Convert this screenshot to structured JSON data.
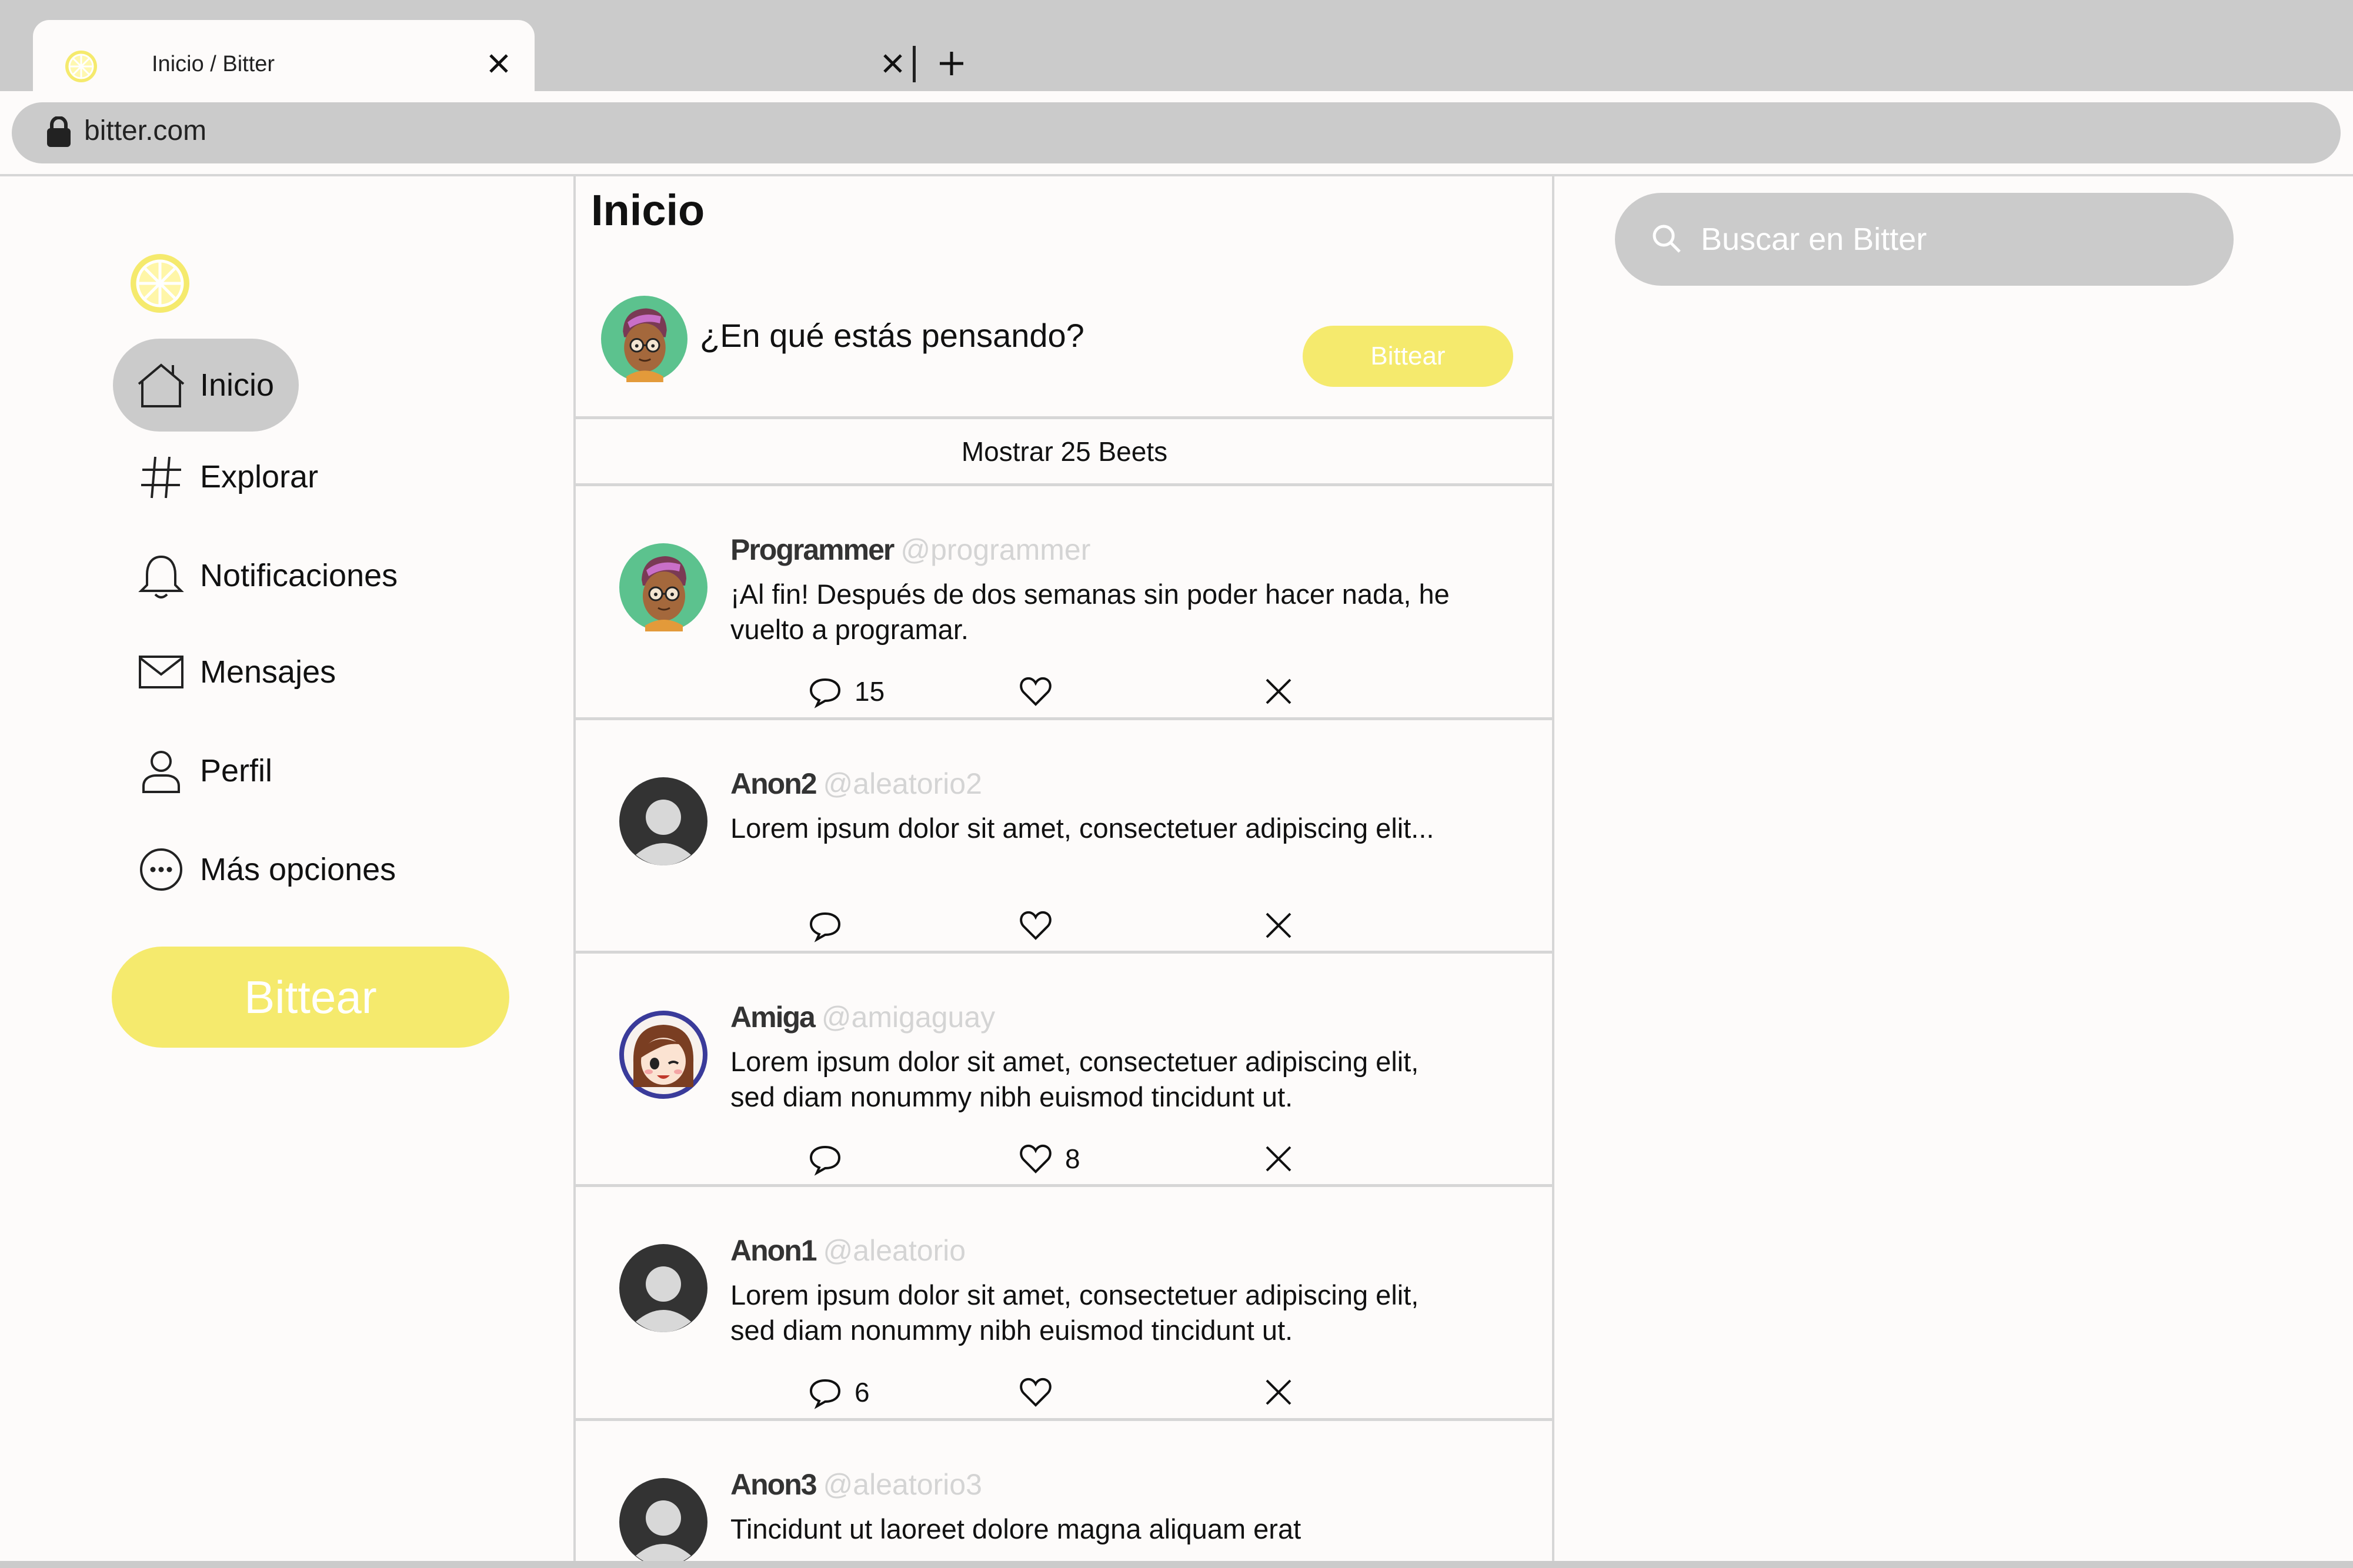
{
  "browser": {
    "tab_title": "Inicio / Bitter",
    "url": "bitter.com",
    "icons": {
      "tab": "lemon-icon",
      "close": "close-icon",
      "new_tab": "plus-icon",
      "lock": "lock-icon"
    }
  },
  "sidebar": {
    "logo": "lemon-logo-icon",
    "items": [
      {
        "label": "Inicio",
        "icon": "home-icon",
        "active": true
      },
      {
        "label": "Explorar",
        "icon": "hashtag-icon"
      },
      {
        "label": "Notificaciones",
        "icon": "bell-icon"
      },
      {
        "label": "Mensajes",
        "icon": "envelope-icon"
      },
      {
        "label": "Perfil",
        "icon": "user-icon"
      },
      {
        "label": "Más opciones",
        "icon": "more-options-icon"
      }
    ],
    "bittear_label": "Bittear"
  },
  "main": {
    "title": "Inicio",
    "composer": {
      "placeholder": "¿En qué estás pensando?",
      "button": "Bittear"
    },
    "show_beets": "Mostrar 25 Beets",
    "posts": [
      {
        "name": "Programmer",
        "handle": "@programmer",
        "text": "¡Al fin! Después de dos semanas sin poder hacer nada, he vuelto a programar.",
        "replies": "15",
        "likes": ""
      },
      {
        "name": "Anon2",
        "handle": "@aleatorio2",
        "text": "Lorem ipsum dolor sit amet, consectetuer adipiscing elit...",
        "replies": "",
        "likes": ""
      },
      {
        "name": "Amiga",
        "handle": "@amigaguay",
        "text": "Lorem ipsum dolor sit amet, consectetuer adipiscing elit,\nsed diam nonummy nibh euismod tincidunt ut.",
        "replies": "",
        "likes": "8"
      },
      {
        "name": "Anon1",
        "handle": "@aleatorio",
        "text": "Lorem ipsum dolor sit amet, consectetuer adipiscing elit,\nsed diam nonummy nibh euismod tincidunt ut.",
        "replies": "6",
        "likes": ""
      },
      {
        "name": "Anon3",
        "handle": "@aleatorio3",
        "text": "Tincidunt ut laoreet dolore magna aliquam erat",
        "replies": "",
        "likes": ""
      }
    ]
  },
  "search": {
    "placeholder": "Buscar en Bitter"
  },
  "colors": {
    "accent": "#f5ea6d",
    "chrome_gray": "#cbcbcb",
    "background": "#fdfbfa",
    "handle_gray": "#d4d4d4"
  }
}
